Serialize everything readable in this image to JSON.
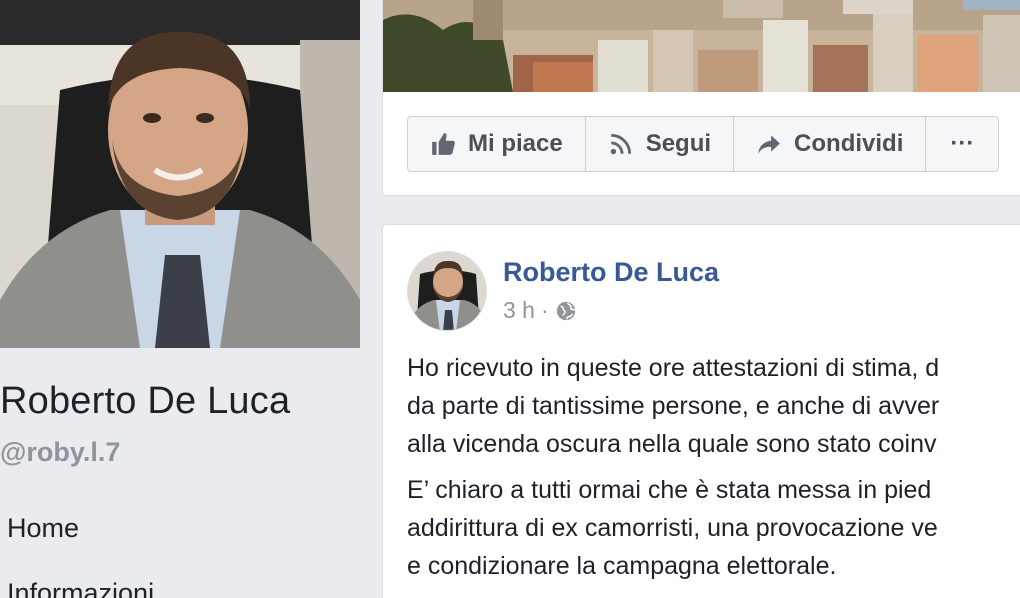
{
  "profile": {
    "name": "Roberto De Luca",
    "username": "@roby.l.7"
  },
  "nav": {
    "items": [
      {
        "label": "Home"
      },
      {
        "label": "Informazioni"
      }
    ]
  },
  "actions": {
    "like_label": "Mi piace",
    "follow_label": "Segui",
    "share_label": "Condividi",
    "more_label": "···"
  },
  "post": {
    "author": "Roberto De Luca",
    "time": "3 h",
    "separator": "·",
    "audience_icon": "globe-icon",
    "paragraph1": [
      "Ho ricevuto in queste ore attestazioni di stima, d",
      "da parte di tantissime persone, e anche di avver",
      "alla vicenda oscura nella quale sono stato coinv"
    ],
    "paragraph2": [
      "E’ chiaro a tutti ormai che è stata messa in pied",
      "addirittura di ex camorristi, una provocazione ve",
      "e condizionare la campagna elettorale."
    ]
  },
  "colors": {
    "page_background": "#e9ebee",
    "link_blue": "#385898",
    "meta_gray": "#90949c",
    "button_text": "#4b4f56"
  }
}
